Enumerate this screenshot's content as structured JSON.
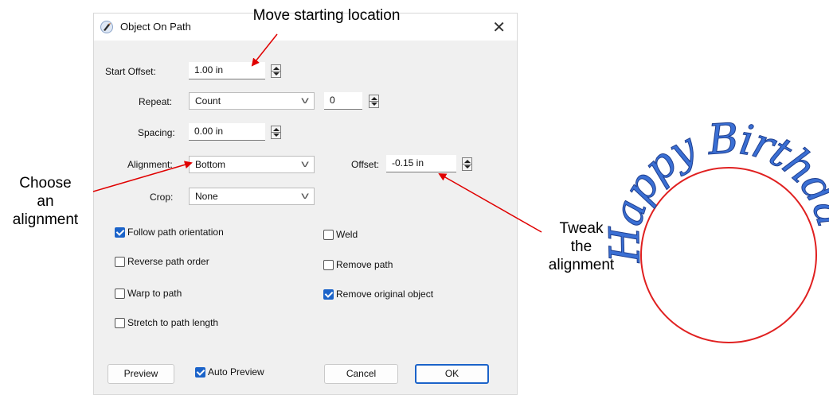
{
  "dialog": {
    "title": "Object On Path",
    "close_glyph": "✕",
    "start_offset": {
      "label": "Start Offset:",
      "value": "1.00 in"
    },
    "repeat": {
      "label": "Repeat:",
      "value": "Count",
      "count": "0"
    },
    "spacing": {
      "label": "Spacing:",
      "value": "0.00 in"
    },
    "alignment": {
      "label": "Alignment:",
      "value": "Bottom"
    },
    "offset": {
      "label": "Offset:",
      "value": "-0.15 in"
    },
    "crop": {
      "label": "Crop:",
      "value": "None"
    },
    "options": {
      "follow_path_orientation": {
        "label": "Follow path orientation",
        "checked": true
      },
      "reverse_path_order": {
        "label": "Reverse path order",
        "checked": false
      },
      "warp_to_path": {
        "label": "Warp to path",
        "checked": false
      },
      "stretch_to_path_length": {
        "label": "Stretch to path length",
        "checked": false
      },
      "weld": {
        "label": "Weld",
        "checked": false
      },
      "remove_path": {
        "label": "Remove path",
        "checked": false
      },
      "remove_original_object": {
        "label": "Remove original object",
        "checked": true
      }
    },
    "buttons": {
      "preview": "Preview",
      "auto_preview": {
        "label": "Auto Preview",
        "checked": true
      },
      "cancel": "Cancel",
      "ok": "OK"
    }
  },
  "annotations": {
    "move_start": "Move starting location",
    "choose_alignment": [
      "Choose",
      "an",
      "alignment"
    ],
    "tweak_alignment": [
      "Tweak",
      "the",
      "alignment"
    ]
  },
  "preview": {
    "text": "Happy Birthday",
    "text_color": "#3a6fd4",
    "circle_color": "#e02020"
  },
  "colors": {
    "accent": "#1b63c9",
    "arrow": "#e00000"
  }
}
